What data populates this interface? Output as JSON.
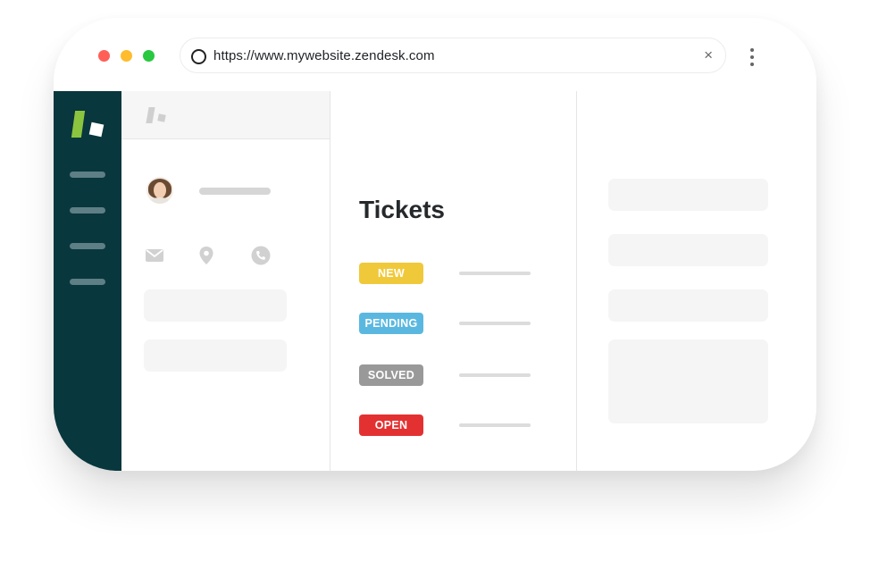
{
  "browser": {
    "url": "https://www.mywebsite.zendesk.com",
    "close_symbol": "×",
    "traffic_lights": [
      "#ff5f57",
      "#febc2e",
      "#28c840"
    ]
  },
  "sidebar": {
    "logo": "zendesk-logo",
    "background": "#08373d",
    "nav_items": 4
  },
  "tickets": {
    "title": "Tickets",
    "statuses": [
      {
        "label": "NEW",
        "color": "#f0c93a"
      },
      {
        "label": "PENDING",
        "color": "#5ab8e0"
      },
      {
        "label": "SOLVED",
        "color": "#999999"
      },
      {
        "label": "OPEN",
        "color": "#e33131"
      }
    ]
  },
  "icons": {
    "mail": "mail-icon",
    "location": "location-pin-icon",
    "phone": "phone-icon",
    "sync": "sync-icon",
    "menu": "kebab-menu-icon"
  },
  "colors": {
    "sync_green": "#10d447",
    "logo_green": "#8bc53f"
  }
}
